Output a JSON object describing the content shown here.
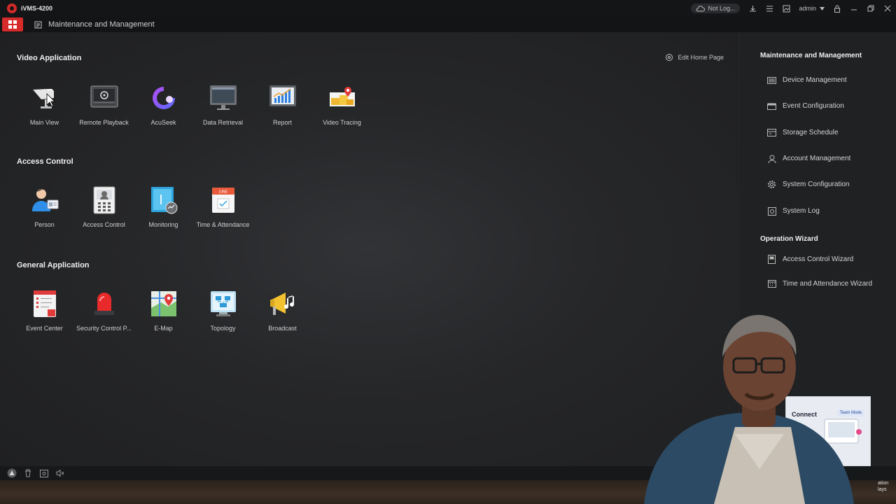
{
  "titlebar": {
    "app_title": "iVMS-4200",
    "not_logged": "Not Log...",
    "user": "admin"
  },
  "tabbar": {
    "tab_label": "Maintenance and Management"
  },
  "main": {
    "edit_home_label": "Edit Home Page",
    "sections": [
      {
        "title": "Video Application",
        "items": [
          {
            "label": "Main View",
            "icon": "camera-icon"
          },
          {
            "label": "Remote Playback",
            "icon": "playback-icon"
          },
          {
            "label": "AcuSeek",
            "icon": "acuseek-icon"
          },
          {
            "label": "Data Retrieval",
            "icon": "monitor-icon"
          },
          {
            "label": "Report",
            "icon": "report-chart-icon"
          },
          {
            "label": "Video Tracing",
            "icon": "map-boxes-icon"
          }
        ]
      },
      {
        "title": "Access Control",
        "items": [
          {
            "label": "Person",
            "icon": "person-card-icon"
          },
          {
            "label": "Access Control",
            "icon": "door-terminal-icon"
          },
          {
            "label": "Monitoring",
            "icon": "door-monitor-icon"
          },
          {
            "label": "Time & Attendance",
            "icon": "calendar-icon"
          }
        ]
      },
      {
        "title": "General Application",
        "items": [
          {
            "label": "Event Center",
            "icon": "event-list-icon"
          },
          {
            "label": "Security Control P...",
            "icon": "alarm-light-icon"
          },
          {
            "label": "E-Map",
            "icon": "map-pin-icon"
          },
          {
            "label": "Topology",
            "icon": "topology-icon"
          },
          {
            "label": "Broadcast",
            "icon": "broadcast-icon"
          }
        ]
      }
    ]
  },
  "right_panel": {
    "maintenance_title": "Maintenance and Management",
    "maintenance_items": [
      {
        "label": "Device Management",
        "icon": "device-icon"
      },
      {
        "label": "Event Configuration",
        "icon": "event-config-icon"
      },
      {
        "label": "Storage Schedule",
        "icon": "storage-icon"
      },
      {
        "label": "Account Management",
        "icon": "account-icon"
      },
      {
        "label": "System Configuration",
        "icon": "gear-icon"
      },
      {
        "label": "System Log",
        "icon": "log-icon"
      }
    ],
    "wizard_title": "Operation Wizard",
    "wizard_items": [
      {
        "label": "Access Control Wizard",
        "icon": "wizard-door-icon"
      },
      {
        "label": "Time and Attendance Wizard",
        "icon": "wizard-calendar-icon"
      }
    ]
  },
  "overlay": {
    "promo_text": "Connect",
    "promo_badge": "Team Mode",
    "side_text_1": "ation",
    "side_text_2": "lays"
  },
  "colors": {
    "accent": "#d52b2b",
    "background": "#1b1c1e"
  }
}
